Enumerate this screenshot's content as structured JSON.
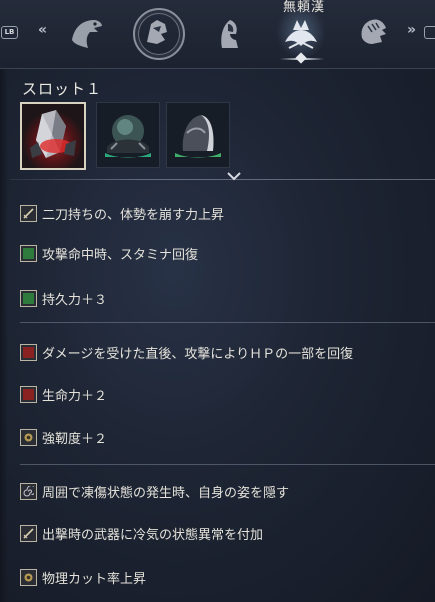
{
  "nav": {
    "lb_label": "LB",
    "left_chevron": "«",
    "right_chevron": "»",
    "selected_title": "無頼漢",
    "icons": [
      "bird-head-icon",
      "raptor-emblem-icon",
      "hooded-figure-icon",
      "raider-emblem-icon",
      "lion-mane-icon"
    ]
  },
  "slot": {
    "title": "スロット１",
    "items": [
      {
        "name": "red-crystal-relic",
        "color": "#c0282c",
        "selected": true
      },
      {
        "name": "green-orb-relic",
        "color": "#2ea87a",
        "selected": false
      },
      {
        "name": "veiled-statue-relic",
        "color": "#3fae6a",
        "selected": false
      }
    ]
  },
  "effects_groups": [
    {
      "items": [
        {
          "icon": "sword-stat-icon",
          "icon_color": "#b9a77a",
          "text": "二刀持ちの、体勢を崩す力上昇"
        },
        {
          "icon": "green-square-icon",
          "icon_color": "#2f7a3d",
          "text": "攻撃命中時、スタミナ回復"
        },
        {
          "icon": "green-square-icon",
          "icon_color": "#2f7a3d",
          "text": "持久力＋３"
        }
      ]
    },
    {
      "items": [
        {
          "icon": "red-square-icon",
          "icon_color": "#8a2222",
          "text": "ダメージを受けた直後、攻撃によりＨＰの一部を回復"
        },
        {
          "icon": "red-square-icon",
          "icon_color": "#8a2222",
          "text": "生命力＋２"
        },
        {
          "icon": "gold-emblem-icon",
          "icon_color": "#b59a55",
          "text": "強靭度＋２"
        }
      ]
    },
    {
      "items": [
        {
          "icon": "spiral-icon",
          "icon_color": "#a8a5b8",
          "text": "周囲で凍傷状態の発生時、自身の姿を隠す"
        },
        {
          "icon": "sword-stat-icon",
          "icon_color": "#b9a77a",
          "text": "出撃時の武器に冷気の状態異常を付加"
        },
        {
          "icon": "gold-emblem-icon",
          "icon_color": "#b59a55",
          "text": "物理カット率上昇"
        }
      ]
    }
  ]
}
